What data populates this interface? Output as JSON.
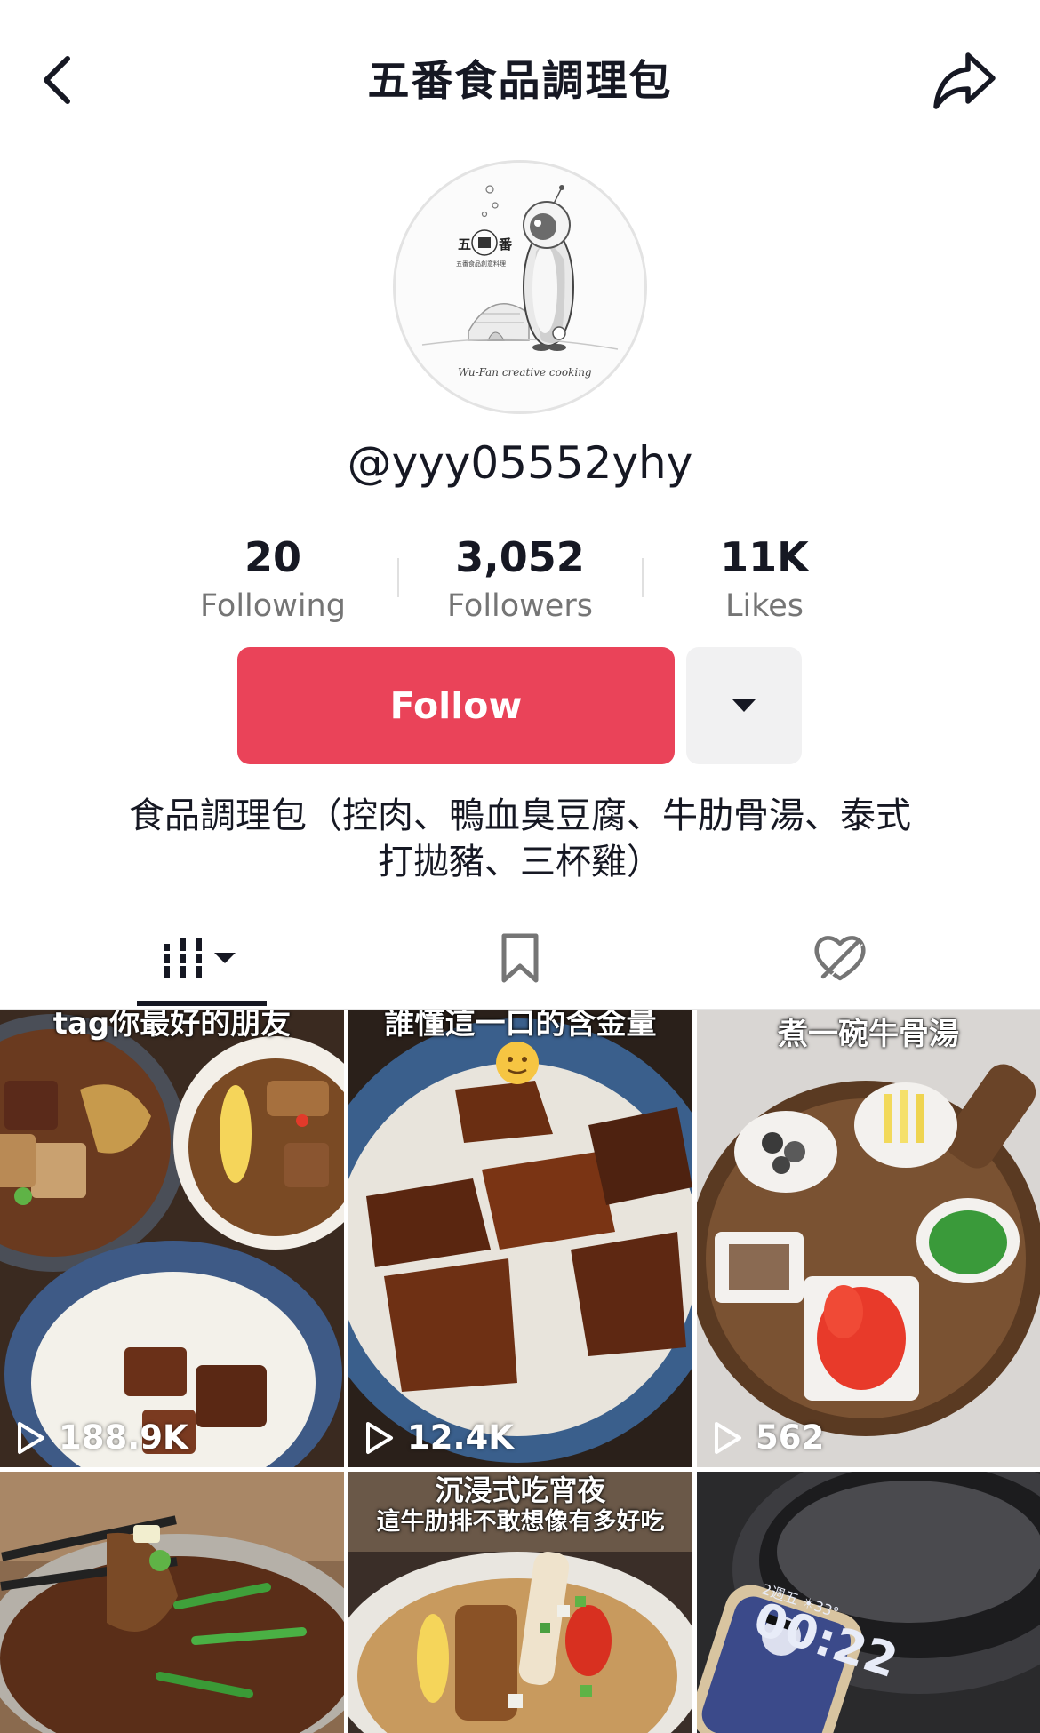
{
  "header": {
    "title": "五番食品調理包",
    "back_icon": "chevron-left-icon",
    "share_icon": "share-arrow-icon"
  },
  "profile": {
    "avatar_logo_text": "五番",
    "avatar_script_text": "Wu-Fan creative cooking",
    "username": "@yyy05552yhy"
  },
  "stats": [
    {
      "value": "20",
      "label": "Following"
    },
    {
      "value": "3,052",
      "label": "Followers"
    },
    {
      "value": "11K",
      "label": "Likes"
    }
  ],
  "actions": {
    "follow_label": "Follow",
    "more_icon": "caret-down-icon",
    "follow_color": "#ea4359"
  },
  "bio": {
    "line1": "食品調理包（控肉、鴨血臭豆腐、牛肋骨湯、泰式",
    "line2": "打拋豬、三杯雞）"
  },
  "tabs": [
    {
      "name": "videos",
      "icon": "grid-bars-icon",
      "selected": true
    },
    {
      "name": "favorites",
      "icon": "bookmark-icon",
      "selected": false
    },
    {
      "name": "liked",
      "icon": "heart-hidden-icon",
      "selected": false
    }
  ],
  "videos": [
    {
      "caption": "tag你最好的朋友",
      "views": "188.9K"
    },
    {
      "caption": "誰懂這一口的含金量",
      "views": "12.4K"
    },
    {
      "caption": "煮一碗牛骨湯",
      "views": "562"
    },
    {
      "caption": "",
      "views": ""
    },
    {
      "caption": "沉浸式吃宵夜",
      "caption2": "這牛肋排不敢想像有多好吃",
      "views": ""
    },
    {
      "caption": "",
      "views": ""
    }
  ],
  "phone_screen": {
    "date": "2週五 ☀33°",
    "time": "00:22"
  }
}
